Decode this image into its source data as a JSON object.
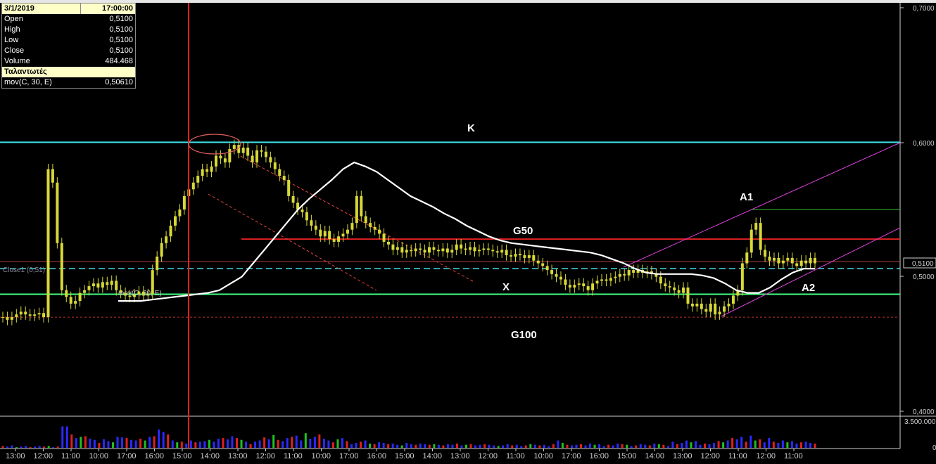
{
  "info_panel": {
    "date": "3/1/2019",
    "time": "17:00:00",
    "rows": [
      {
        "label": "Open",
        "value": "0,5100"
      },
      {
        "label": "High",
        "value": "0,5100"
      },
      {
        "label": "Low",
        "value": "0,5100"
      },
      {
        "label": "Close",
        "value": "0,5100"
      },
      {
        "label": "Volume",
        "value": "484.468"
      }
    ],
    "section_title": "Ταλαντωτές",
    "indicator_label": "mov(C, 30, E)",
    "indicator_value": "0,50610"
  },
  "annotations": {
    "k": "K",
    "g50": "G50",
    "x": "X",
    "g100": "G100",
    "a1": "A1",
    "a2": "A2",
    "close_line": "Close1 (0,51)",
    "mov_line": "mov(C, 30, E)"
  },
  "colors": {
    "background": "#000000",
    "candle": "#d8d838",
    "moving_average": "#ffffff",
    "line_k": "#40e0e8",
    "line_g50": "#e02020",
    "line_x": "#40ff80",
    "line_close": "#40e0e8",
    "line_g100": "#c03030",
    "channel": "#e040e0",
    "vol_up": "#2a2aff",
    "vol_down": "#e02020",
    "vol_flat": "#20c020"
  },
  "chart_data": {
    "type": "candlestick",
    "ylim": [
      0.4,
      0.7
    ],
    "y_ticks": [
      "0,7000",
      "0,6000",
      "0,5000",
      "0,4000"
    ],
    "y_tick_values": [
      0.7,
      0.6,
      0.5,
      0.4
    ],
    "last_price_label": "0,5100",
    "last_price": 0.51,
    "volume_ticks": [
      "3.500.000",
      "0"
    ],
    "volume_max": 3500000,
    "x_labels": [
      "13:00",
      "12:00",
      "11:00",
      "10:00",
      "17:00",
      "16:00",
      "15:00",
      "14:00",
      "13:00",
      "12:00",
      "11:00",
      "10:00",
      "17:00",
      "16:00",
      "15:00",
      "14:00",
      "13:00",
      "12:00",
      "11:00",
      "10:00",
      "17:00",
      "16:00",
      "15:00",
      "14:00",
      "13:00",
      "12:00",
      "11:00",
      "12:00",
      "11:00"
    ],
    "levels": {
      "k": 0.6,
      "g50": 0.528,
      "close": 0.506,
      "x": 0.487,
      "g100": 0.47
    },
    "close_prices": [
      0.47,
      0.468,
      0.47,
      0.472,
      0.474,
      0.472,
      0.471,
      0.472,
      0.473,
      0.47,
      0.58,
      0.57,
      0.525,
      0.49,
      0.485,
      0.48,
      0.482,
      0.488,
      0.49,
      0.493,
      0.495,
      0.492,
      0.496,
      0.494,
      0.497,
      0.49,
      0.488,
      0.486,
      0.485,
      0.487,
      0.489,
      0.486,
      0.487,
      0.505,
      0.515,
      0.525,
      0.53,
      0.538,
      0.545,
      0.55,
      0.56,
      0.565,
      0.57,
      0.575,
      0.58,
      0.578,
      0.582,
      0.59,
      0.588,
      0.585,
      0.595,
      0.598,
      0.592,
      0.596,
      0.59,
      0.585,
      0.594,
      0.593,
      0.589,
      0.585,
      0.58,
      0.575,
      0.572,
      0.56,
      0.555,
      0.55,
      0.548,
      0.542,
      0.538,
      0.535,
      0.53,
      0.534,
      0.528,
      0.526,
      0.53,
      0.532,
      0.535,
      0.54,
      0.56,
      0.545,
      0.54,
      0.537,
      0.535,
      0.532,
      0.526,
      0.524,
      0.52,
      0.522,
      0.518,
      0.52,
      0.519,
      0.521,
      0.52,
      0.518,
      0.522,
      0.52,
      0.519,
      0.521,
      0.518,
      0.52,
      0.524,
      0.521,
      0.52,
      0.522,
      0.519,
      0.52,
      0.521,
      0.52,
      0.519,
      0.518,
      0.52,
      0.516,
      0.515,
      0.517,
      0.516,
      0.514,
      0.516,
      0.512,
      0.51,
      0.508,
      0.505,
      0.502,
      0.5,
      0.498,
      0.494,
      0.492,
      0.494,
      0.495,
      0.493,
      0.49,
      0.495,
      0.497,
      0.498,
      0.497,
      0.499,
      0.5,
      0.502,
      0.501,
      0.505,
      0.503,
      0.505,
      0.503,
      0.504,
      0.502,
      0.5,
      0.495,
      0.493,
      0.492,
      0.49,
      0.488,
      0.492,
      0.48,
      0.478,
      0.48,
      0.476,
      0.474,
      0.48,
      0.472,
      0.474,
      0.478,
      0.48,
      0.486,
      0.49,
      0.51,
      0.518,
      0.535,
      0.54,
      0.52,
      0.515,
      0.512,
      0.514,
      0.51,
      0.512,
      0.514,
      0.51,
      0.508,
      0.512,
      0.51,
      0.514,
      0.51
    ],
    "moving_average": [
      0.482,
      0.482,
      0.482,
      0.483,
      0.484,
      0.485,
      0.486,
      0.487,
      0.488,
      0.49,
      0.495,
      0.5,
      0.51,
      0.52,
      0.53,
      0.54,
      0.55,
      0.558,
      0.565,
      0.572,
      0.58,
      0.585,
      0.582,
      0.578,
      0.572,
      0.566,
      0.56,
      0.556,
      0.552,
      0.547,
      0.543,
      0.538,
      0.534,
      0.53,
      0.527,
      0.525,
      0.524,
      0.523,
      0.522,
      0.521,
      0.52,
      0.519,
      0.518,
      0.516,
      0.513,
      0.51,
      0.506,
      0.503,
      0.502,
      0.502,
      0.502,
      0.502,
      0.501,
      0.499,
      0.495,
      0.49,
      0.488,
      0.488,
      0.492,
      0.498,
      0.503,
      0.506,
      0.506
    ],
    "volumes": [
      0.3,
      0.2,
      0.4,
      0.1,
      0.2,
      0.3,
      0.1,
      0.2,
      0.3,
      0.2,
      0.3,
      0.1,
      0.2,
      3.5,
      5.0,
      2.2,
      1.6,
      1.8,
      1.9,
      1.5,
      1.3,
      0.8,
      1.4,
      1.1,
      0.9,
      1.8,
      1.7,
      1.6,
      1.3,
      1.2,
      1.5,
      1.2,
      1.8,
      1.9,
      3.0,
      2.6,
      2.2,
      1.2,
      0.9,
      1.0,
      0.7,
      1.2,
      0.9,
      1.0,
      1.1,
      1.3,
      1.0,
      1.5,
      1.6,
      1.4,
      1.9,
      1.6,
      1.3,
      1.0,
      0.6,
      1.0,
      1.2,
      1.7,
      1.4,
      2.1,
      1.3,
      1.1,
      1.6,
      1.8,
      2.0,
      1.2,
      2.4,
      1.5,
      1.8,
      2.2,
      1.5,
      1.2,
      0.9,
      1.4,
      1.6,
      1.1,
      0.6,
      0.8,
      1.0,
      1.2,
      0.7,
      0.6,
      0.9,
      0.8,
      0.6,
      0.7,
      0.5,
      0.4,
      0.8,
      0.6,
      0.5,
      0.7,
      0.6,
      0.5,
      0.6,
      0.5,
      0.4,
      0.6,
      0.5,
      0.7,
      0.4,
      0.5,
      0.6,
      0.4,
      0.5,
      0.6,
      0.5,
      0.4,
      0.3,
      0.4,
      0.6,
      0.4,
      0.5,
      0.3,
      0.4,
      0.6,
      0.5,
      0.4,
      0.5,
      0.3,
      0.6,
      1.2,
      0.8,
      0.5,
      0.4,
      0.5,
      0.6,
      0.4,
      0.7,
      0.5,
      0.6,
      0.3,
      0.5,
      0.4,
      0.7,
      0.6,
      0.5,
      0.3,
      0.4,
      0.6,
      0.5,
      0.4,
      0.7,
      0.6,
      0.5,
      0.3,
      1.0,
      0.6,
      0.8,
      1.2,
      0.9,
      1.1,
      0.5,
      0.7,
      0.6,
      0.8,
      1.1,
      0.9,
      1.2,
      1.6,
      1.4,
      1.8,
      1.0,
      2.0,
      1.2,
      1.4,
      0.9,
      1.6,
      1.0,
      0.8,
      1.2,
      0.9,
      1.1,
      0.7,
      0.9,
      1.0,
      0.8,
      0.7
    ]
  }
}
